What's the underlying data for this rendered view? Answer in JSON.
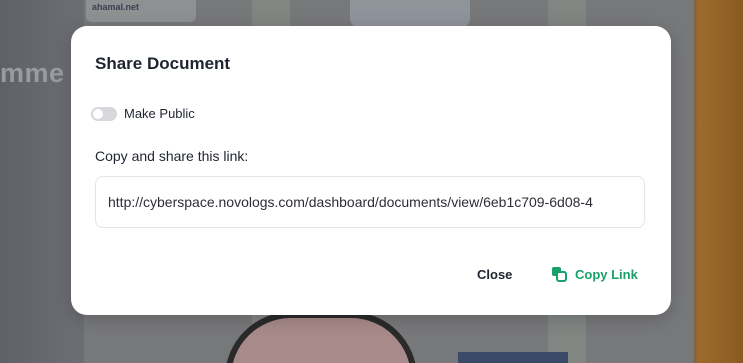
{
  "background": {
    "partial_heading": "mme",
    "logo_text": "ahamal.net"
  },
  "dialog": {
    "title": "Share Document",
    "make_public": {
      "label": "Make Public",
      "enabled": false
    },
    "share_label": "Copy and share this link:",
    "link_value": "http://cyberspace.novologs.com/dashboard/documents/view/6eb1c709-6d08-4",
    "actions": {
      "close_label": "Close",
      "copy_label": "Copy Link"
    }
  },
  "colors": {
    "accent": "#1aa06a",
    "text": "#1f2430",
    "toggle_off": "#d6d8dc"
  },
  "icons": {
    "copy": "copy-icon"
  }
}
